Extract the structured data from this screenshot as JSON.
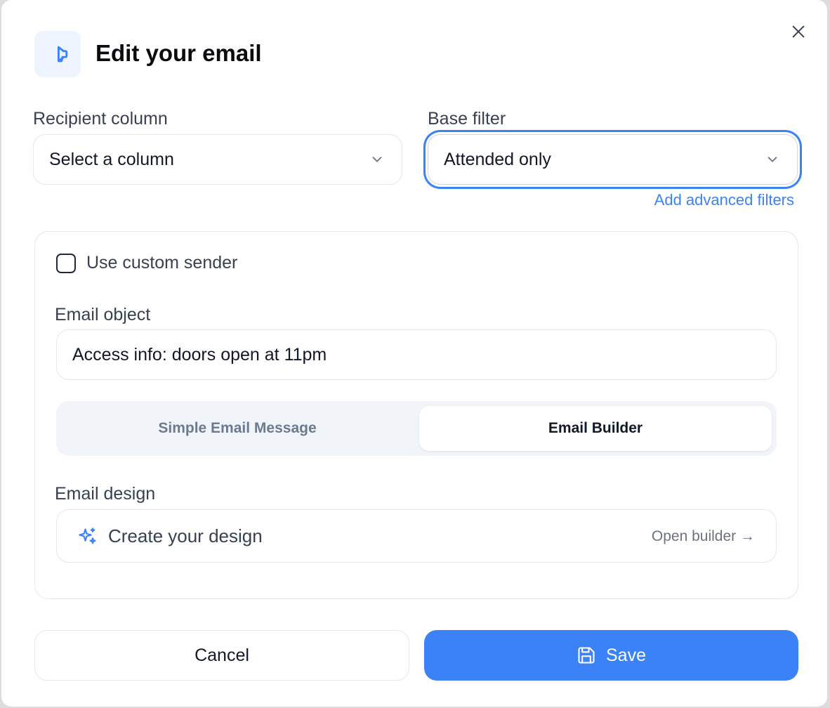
{
  "modal": {
    "title": "Edit your email",
    "header_icon": "megaphone-icon",
    "close_icon": "close-icon"
  },
  "recipient": {
    "label": "Recipient column",
    "placeholder": "Select a column"
  },
  "base_filter": {
    "label": "Base filter",
    "value": "Attended only",
    "advanced_link": "Add advanced filters"
  },
  "sender": {
    "checkbox_label": "Use custom sender",
    "checked": false
  },
  "email_object": {
    "label": "Email object",
    "value": "Access info: doors open at 11pm"
  },
  "mode_tabs": [
    {
      "label": "Simple Email Message",
      "active": false
    },
    {
      "label": "Email Builder",
      "active": true
    }
  ],
  "design": {
    "label": "Email design",
    "text": "Create your design",
    "action": "Open builder →",
    "icon": "sparkles-icon"
  },
  "footer": {
    "cancel_label": "Cancel",
    "save_label": "Save",
    "save_icon": "floppy-disk-icon"
  },
  "colors": {
    "accent": "#3b82f6",
    "header_icon_bg": "#eef4fd",
    "tabs_bg": "#f1f5f9"
  }
}
